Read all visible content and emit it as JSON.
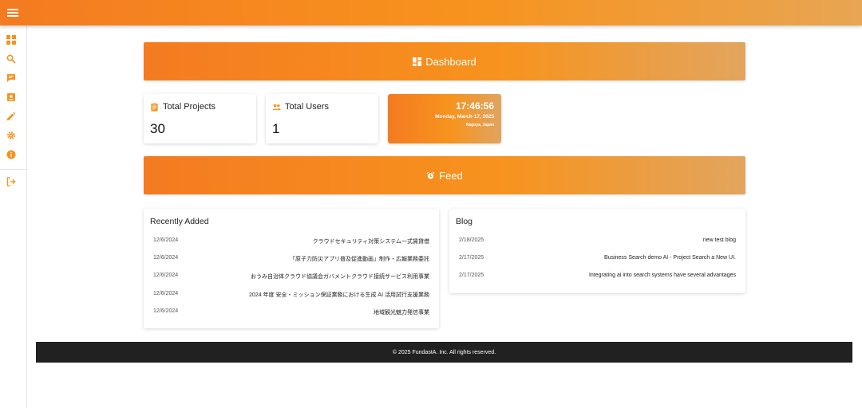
{
  "colors": {
    "accent": "#f7931e",
    "accent_dark": "#f47b20",
    "footer_bg": "#212121"
  },
  "sidebar": {
    "items": [
      {
        "icon": "dashboard-icon"
      },
      {
        "icon": "search-icon"
      },
      {
        "icon": "chat-icon"
      },
      {
        "icon": "contact-card-icon"
      },
      {
        "icon": "pencil-icon"
      },
      {
        "icon": "gear-icon"
      },
      {
        "icon": "info-icon"
      },
      {
        "icon": "logout-icon"
      }
    ]
  },
  "dashboard_banner": {
    "label": "Dashboard",
    "icon": "dashboard-icon"
  },
  "stats": {
    "projects": {
      "label": "Total Projects",
      "value": "30",
      "icon": "clipboard-icon"
    },
    "users": {
      "label": "Total Users",
      "value": "1",
      "icon": "group-icon"
    }
  },
  "clock": {
    "time": "17:46:56",
    "date": "Monday, March 17, 2025",
    "location": "Nagoya, Japan"
  },
  "feed_banner": {
    "label": "Feed",
    "icon": "alarm-icon"
  },
  "recent": {
    "title": "Recently Added",
    "items": [
      {
        "date": "12/6/2024",
        "text": "クラウドセキュリティ対策システム一式賃貸借"
      },
      {
        "date": "12/6/2024",
        "text": "「原子力防災アプリ普及促進動画」制作・広報業務委託"
      },
      {
        "date": "12/6/2024",
        "text": "おうみ自治体クラウド協議会ガバメントクラウド接続サービス利用事業"
      },
      {
        "date": "12/6/2024",
        "text": "2024 年度 安全・ミッション保証業務における生成 AI 活用試行支援業務"
      },
      {
        "date": "12/6/2024",
        "text": "地域観光魅力発信事業"
      }
    ]
  },
  "blog": {
    "title": "Blog",
    "items": [
      {
        "date": "2/18/2025",
        "text": "new test blog"
      },
      {
        "date": "2/17/2025",
        "text": "Business Search demo AI - Project Search a New UI."
      },
      {
        "date": "2/17/2025",
        "text": "Integrating ai into search systems have several advantages"
      }
    ]
  },
  "footer": {
    "text": "© 2025 FundastA. Inc. All rights reserved."
  }
}
